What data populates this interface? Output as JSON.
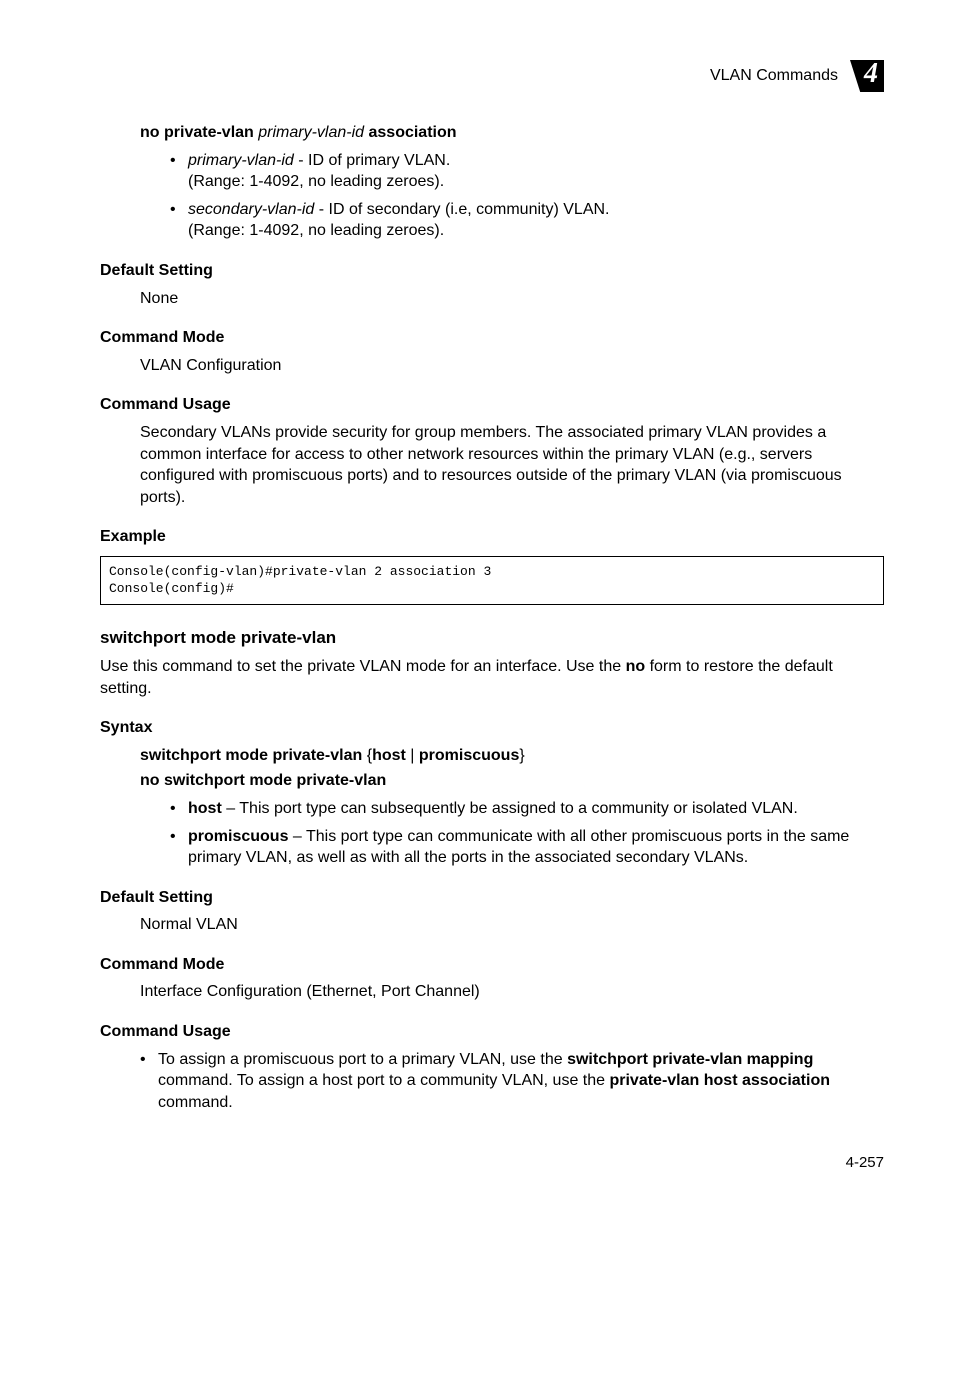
{
  "header": {
    "title": "VLAN Commands",
    "chapter": "4"
  },
  "s1": {
    "syntax": {
      "pre": "no private-vlan ",
      "italic": "primary-vlan-id",
      "post": " association"
    },
    "bullets": {
      "b1_italic": "primary-vlan-id",
      "b1_rest": " - ID of primary VLAN.",
      "b1_line2": "(Range: 1-4092, no leading zeroes).",
      "b2_italic": "secondary-vlan-id",
      "b2_rest": " - ID of secondary (i.e, community) VLAN.",
      "b2_line2": "(Range: 1-4092, no leading zeroes)."
    },
    "default_heading": "Default Setting",
    "default_value": "None",
    "mode_heading": "Command Mode",
    "mode_value": "VLAN Configuration",
    "usage_heading": "Command Usage",
    "usage_text": "Secondary VLANs provide security for group members. The associated primary VLAN provides a common interface for access to other network resources within the primary VLAN (e.g., servers configured with promiscuous ports) and to resources outside of the primary VLAN (via promiscuous ports).",
    "example_heading": "Example",
    "code": "Console(config-vlan)#private-vlan 2 association 3\nConsole(config)#"
  },
  "s2": {
    "title": "switchport mode private-vlan",
    "intro_pre": "Use this command to set the private VLAN mode for an interface. Use the ",
    "intro_bold": "no",
    "intro_post": " form to restore the default setting.",
    "syntax_heading": "Syntax",
    "syntax_line1_pre": "switchport mode private-vlan ",
    "syntax_line1_brace_open": "{",
    "syntax_line1_host": "host",
    "syntax_line1_pipe": " | ",
    "syntax_line1_prom": "promiscuous",
    "syntax_line1_brace_close": "}",
    "syntax_line2": "no switchport mode private-vlan",
    "bullets": {
      "b1_bold": "host",
      "b1_rest": " – This port type can subsequently be assigned to a community or isolated VLAN.",
      "b2_bold": "promiscuous",
      "b2_rest": " – This port type can communicate with all other promiscuous ports in the same primary VLAN, as well as with all the ports in the associated secondary VLANs."
    },
    "default_heading": "Default Setting",
    "default_value": "Normal VLAN",
    "mode_heading": "Command Mode",
    "mode_value": "Interface Configuration (Ethernet, Port Channel)",
    "usage_heading": "Command Usage",
    "usage_bullet_pre": "To assign a promiscuous port to a primary VLAN, use the ",
    "usage_bullet_b1": "switchport private-vlan mapping",
    "usage_bullet_mid": " command. To assign a host port to a community VLAN, use the ",
    "usage_bullet_b2": "private-vlan host association",
    "usage_bullet_post": " command."
  },
  "page_number": "4-257"
}
